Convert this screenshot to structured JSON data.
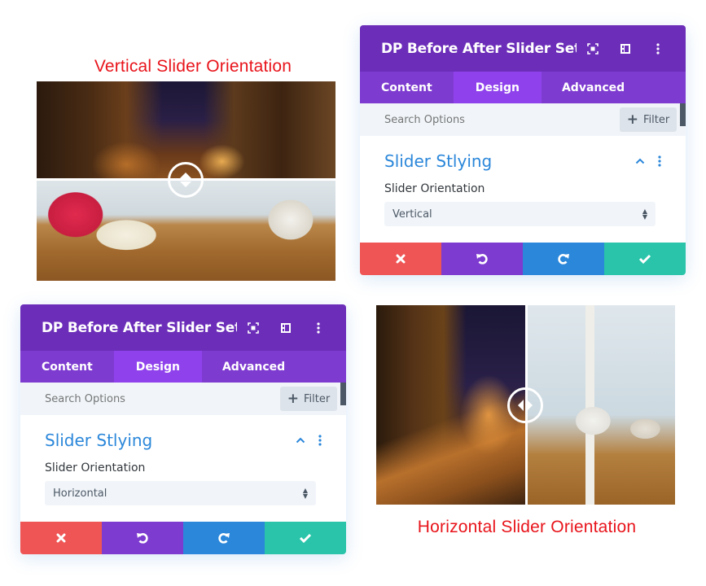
{
  "captions": {
    "vertical": "Vertical Slider Orientation",
    "horizontal": "Horizontal Slider Orientation"
  },
  "colors": {
    "caption": "#e8141b",
    "header": "#6c2eb9",
    "tabs": "#7e3bd0",
    "tab_active": "#8f42ec",
    "accent_blue": "#2b87da",
    "cancel": "#ef5555",
    "undo": "#7e3bd0",
    "redo": "#2b87da",
    "save": "#29c4a9"
  },
  "panels": [
    {
      "title": "DP Before After Slider Setti...",
      "header_icons": [
        "fullscreen-icon",
        "split-view-icon",
        "more-options-icon"
      ],
      "tabs": [
        {
          "label": "Content",
          "active": false
        },
        {
          "label": "Design",
          "active": true
        },
        {
          "label": "Advanced",
          "active": false
        }
      ],
      "search_placeholder": "Search Options",
      "filter_label": "Filter",
      "section_title": "Slider Stlying",
      "field_label": "Slider Orientation",
      "field_value": "Vertical",
      "footer": [
        "cancel-icon",
        "undo-icon",
        "redo-icon",
        "save-check-icon"
      ]
    },
    {
      "title": "DP Before After Slider Setti...",
      "header_icons": [
        "fullscreen-icon",
        "split-view-icon",
        "more-options-icon"
      ],
      "tabs": [
        {
          "label": "Content",
          "active": false
        },
        {
          "label": "Design",
          "active": true
        },
        {
          "label": "Advanced",
          "active": false
        }
      ],
      "search_placeholder": "Search Options",
      "filter_label": "Filter",
      "section_title": "Slider Stlying",
      "field_label": "Slider Orientation",
      "field_value": "Horizontal",
      "footer": [
        "cancel-icon",
        "undo-icon",
        "redo-icon",
        "save-check-icon"
      ]
    }
  ],
  "sliders": {
    "vertical": {
      "orientation": "vertical",
      "before_image": "night-street-photo",
      "after_image": "room-interior-photo",
      "position_percent": 49
    },
    "horizontal": {
      "orientation": "horizontal",
      "before_image": "night-street-photo",
      "after_image": "room-interior-photo",
      "position_percent": 50
    }
  }
}
